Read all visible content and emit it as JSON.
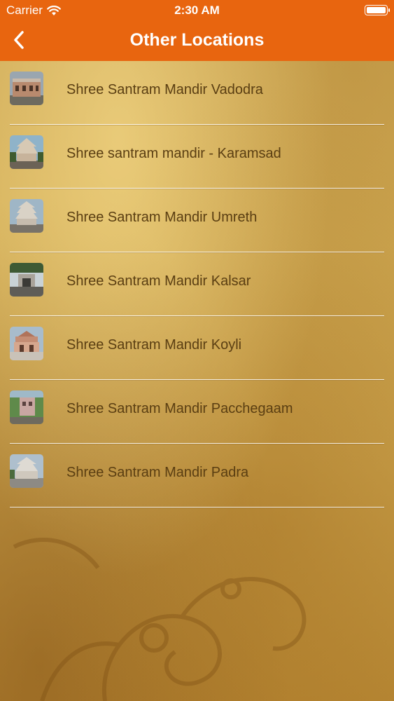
{
  "status_bar": {
    "carrier": "Carrier",
    "time": "2:30 AM",
    "wifi_icon": "wifi-icon",
    "battery_icon": "battery-icon"
  },
  "nav": {
    "title": "Other Locations",
    "back_icon": "chevron-left-icon"
  },
  "colors": {
    "nav_background": "#e8650f",
    "label_text": "#5a3e12",
    "divider": "#ffffff"
  },
  "locations": [
    {
      "name": "Shree Santram Mandir Vadodra",
      "thumb_icon": "temple-photo"
    },
    {
      "name": "Shree santram mandir - Karamsad",
      "thumb_icon": "temple-photo"
    },
    {
      "name": "Shree Santram Mandir Umreth",
      "thumb_icon": "temple-photo"
    },
    {
      "name": "Shree Santram Mandir Kalsar",
      "thumb_icon": "temple-photo"
    },
    {
      "name": "Shree Santram Mandir Koyli",
      "thumb_icon": "temple-photo"
    },
    {
      "name": "Shree Santram Mandir Pacchegaam",
      "thumb_icon": "temple-photo"
    },
    {
      "name": "Shree Santram Mandir Padra",
      "thumb_icon": "temple-photo"
    }
  ]
}
